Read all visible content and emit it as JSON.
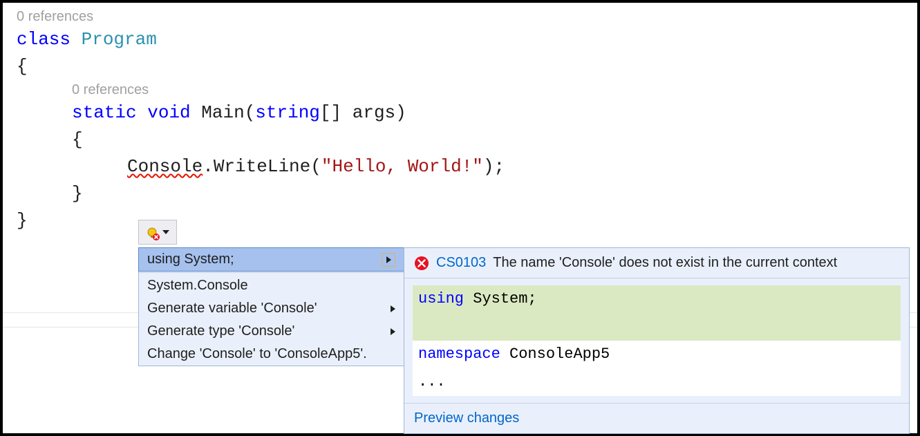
{
  "codelens": {
    "class": "0 references",
    "main": "0 references"
  },
  "code": {
    "class_kw": "class",
    "class_name": "Program",
    "open_brace": "{",
    "static_kw": "static",
    "void_kw": "void",
    "main_name": "Main",
    "main_params_open": "(",
    "string_kw": "string",
    "brackets": "[]",
    "args": "args",
    "main_params_close": ")",
    "body_open": "{",
    "console": "Console",
    "dot": ".",
    "writeline": "WriteLine",
    "call_open": "(",
    "hello": "\"Hello, World!\"",
    "call_close_semi": ");",
    "body_close": "}",
    "close_brace": "}"
  },
  "quickfix": {
    "items": [
      {
        "label": "using System;",
        "selected": true,
        "submenu": true,
        "boxed_arrow": true
      },
      {
        "label": "System.Console",
        "selected": false,
        "submenu": false
      },
      {
        "label": "Generate variable 'Console'",
        "selected": false,
        "submenu": true
      },
      {
        "label": "Generate type 'Console'",
        "selected": false,
        "submenu": true
      },
      {
        "label": "Change 'Console' to 'ConsoleApp5'.",
        "selected": false,
        "submenu": false
      }
    ]
  },
  "preview": {
    "error_code": "CS0103",
    "error_msg": "The name 'Console' does not exist in the current context",
    "added_using_kw": "using",
    "added_using_ns": " System;",
    "ns_kw": "namespace",
    "ns_name": " ConsoleApp5",
    "ellipsis": "...",
    "footer": "Preview changes"
  }
}
